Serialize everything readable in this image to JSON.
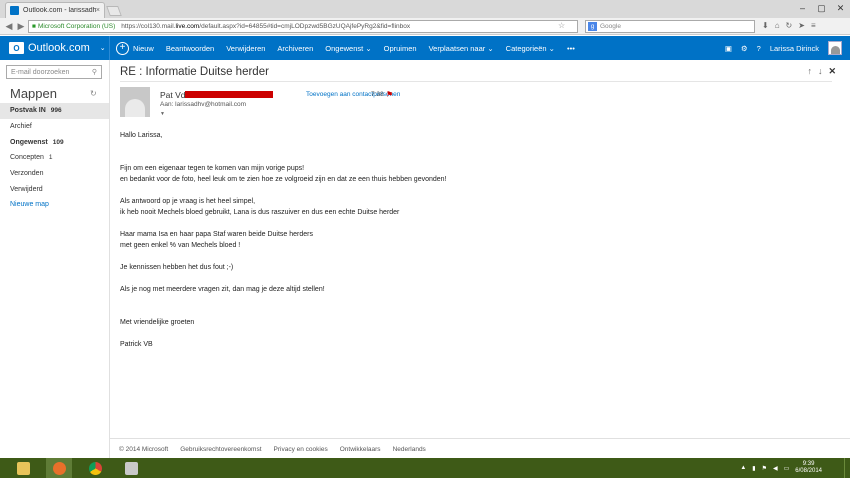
{
  "browser": {
    "tab_title": "Outlook.com - larissadhv...",
    "tab_close": "×",
    "org_label": "Microsoft Corporation (US)",
    "url_prefix": "https://col130.mail.",
    "url_domain": "live.com",
    "url_rest": "/default.aspx?id=64855#tid=cmjLODpzwd5BGzUQAjfePyRg2&fid=flinbox",
    "search_placeholder": "Google",
    "window_controls": [
      "–",
      "▢",
      "✕"
    ]
  },
  "appbar": {
    "logo_text": "Outlook.com",
    "new_label": "Nieuw",
    "commands": [
      "Beantwoorden",
      "Verwijderen",
      "Archiveren",
      "Ongewenst",
      "Opruimen",
      "Verplaatsen naar",
      "Categorieën",
      "•••"
    ],
    "user_name": "Larissa Dirinck"
  },
  "sidebar": {
    "search_placeholder": "E-mail doorzoeken",
    "heading": "Mappen",
    "folders": [
      {
        "label": "Postvak IN",
        "count": "996"
      },
      {
        "label": "Archief",
        "count": ""
      },
      {
        "label": "Ongewenst",
        "count": "109"
      },
      {
        "label": "Concepten",
        "count": "1"
      },
      {
        "label": "Verzonden",
        "count": ""
      },
      {
        "label": "Verwijderd",
        "count": ""
      },
      {
        "label": "Nieuwe map",
        "count": ""
      }
    ]
  },
  "message": {
    "subject": "RE : Informatie Duitse herder",
    "sender": "Pat Vdw",
    "add_contact": "Toevoegen aan contactpersonen",
    "time": "7:38",
    "to": "Aan: larissadhv@hotmail.com",
    "body": [
      "Hallo Larissa,",
      "",
      "",
      "Fijn om een eigenaar tegen te komen van mijn vorige pups!",
      "en bedankt voor de foto, heel leuk om te zien hoe ze volgroeid zijn en dat ze een thuis hebben gevonden!",
      "",
      "Als antwoord op je vraag is het heel simpel,",
      "ik heb nooit Mechels bloed gebruikt, Lana is dus raszuiver en dus een echte Duitse herder",
      "",
      "Haar mama Isa en haar papa Staf waren beide Duitse herders",
      "met geen enkel % van Mechels bloed !",
      "",
      "Je kennissen hebben het dus fout ;-)",
      "",
      "Als je nog met meerdere vragen zit, dan mag je deze altijd stellen!",
      "",
      "",
      "Met vriendelijke groeten",
      "",
      "Patrick VB"
    ]
  },
  "footer": {
    "links": [
      "© 2014 Microsoft",
      "Gebruiksrechtovereenkomst",
      "Privacy en cookies",
      "Ontwikkelaars",
      "Nederlands"
    ]
  },
  "taskbar": {
    "time": "9:39",
    "date": "6/08/2014"
  }
}
